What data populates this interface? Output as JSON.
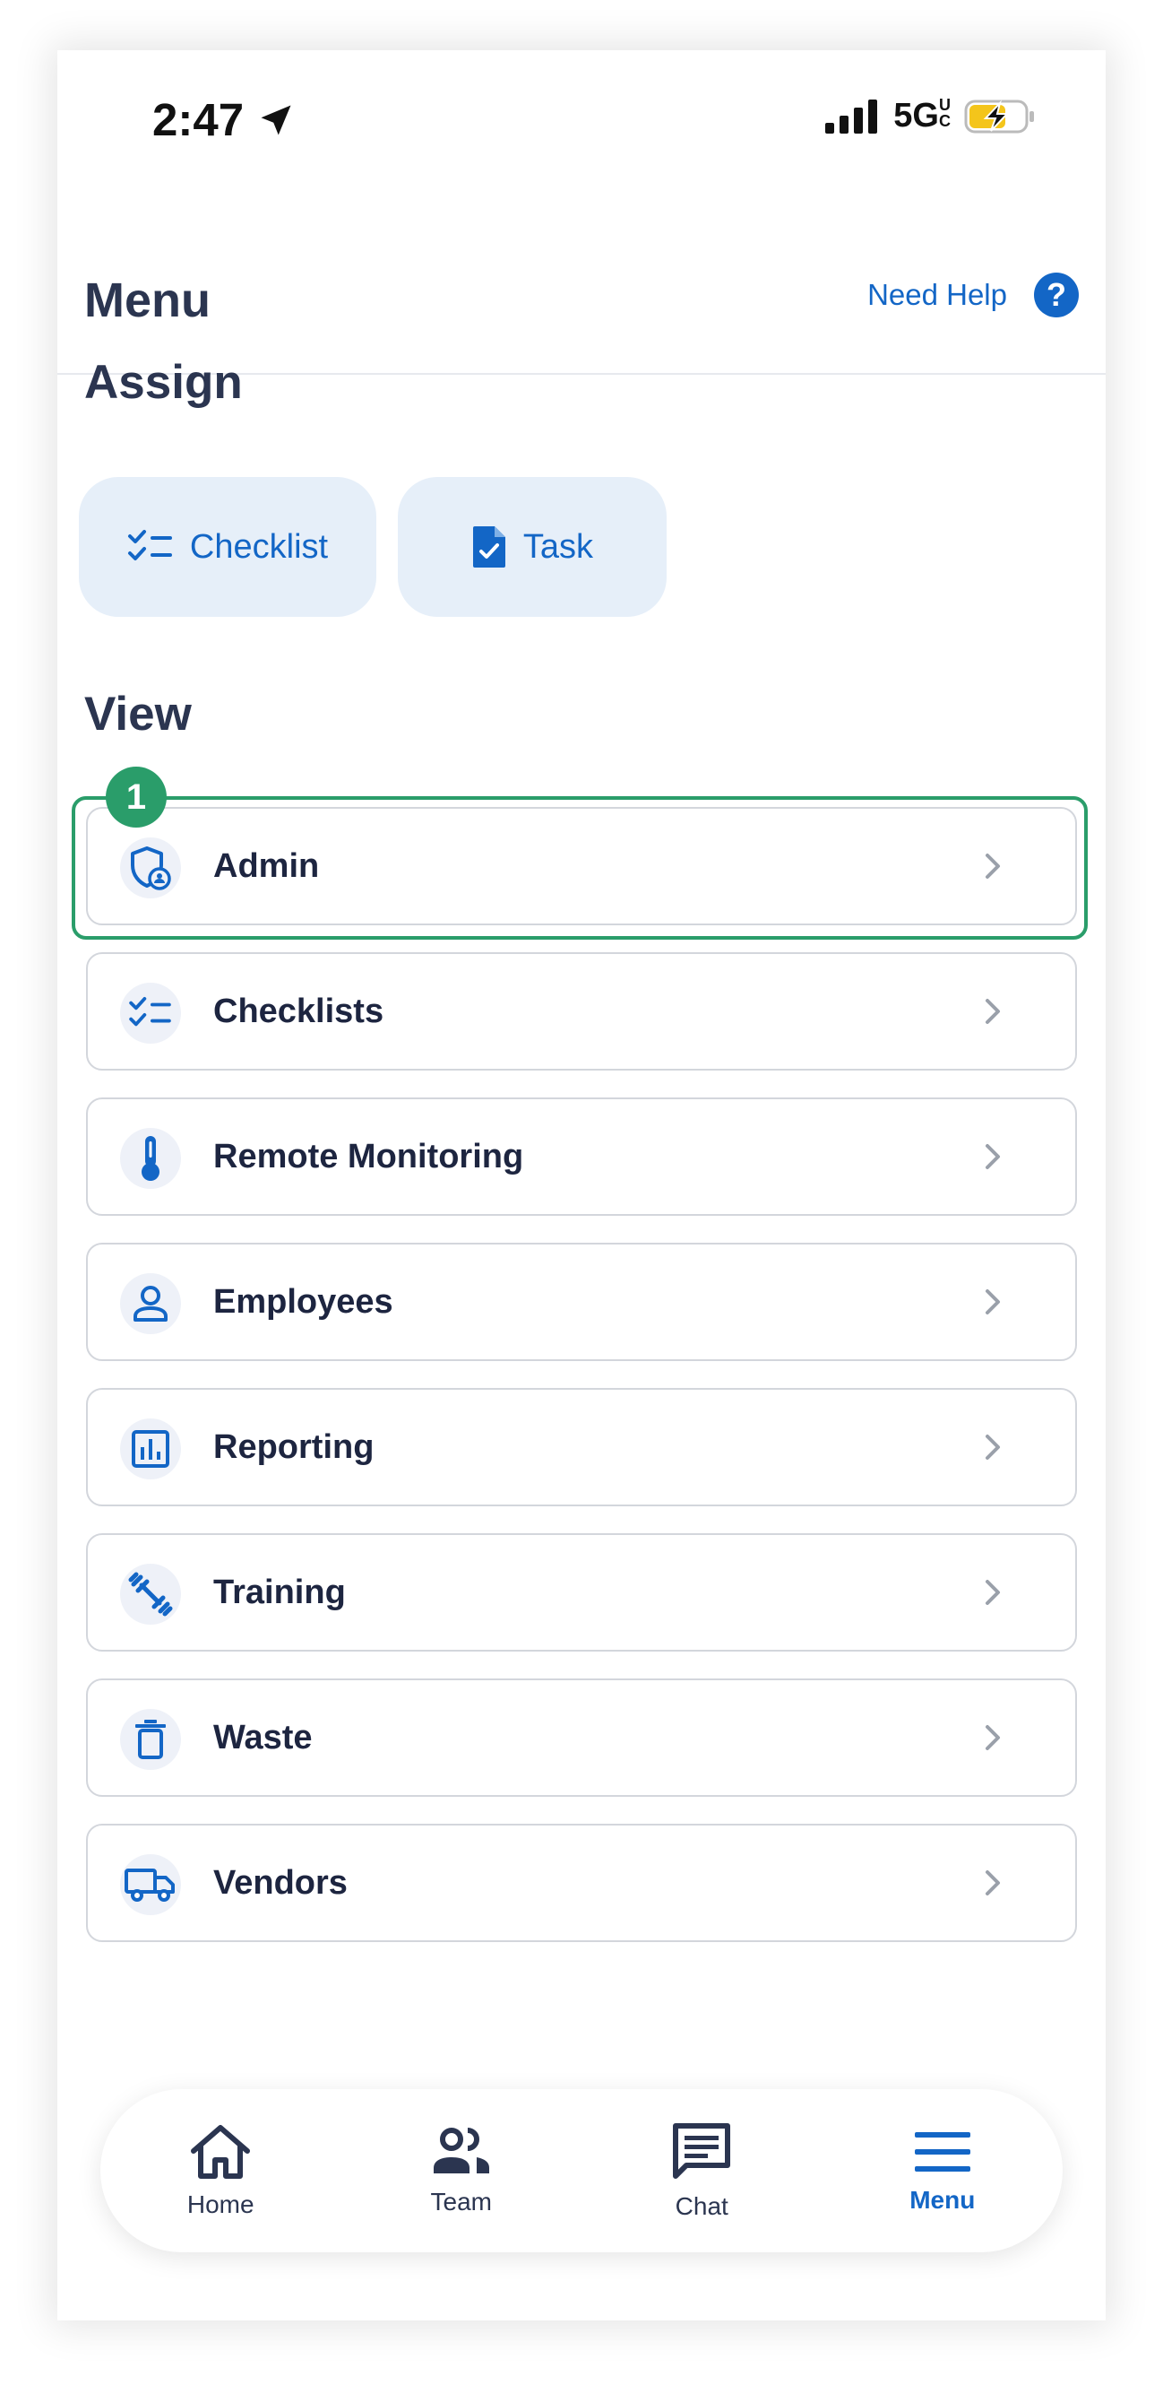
{
  "status": {
    "time": "2:47",
    "network": "5G",
    "network_badge": "UC"
  },
  "header": {
    "title": "Menu",
    "help_label": "Need Help",
    "help_symbol": "?"
  },
  "assign": {
    "title": "Assign",
    "buttons": [
      {
        "label": "Checklist",
        "icon": "checklist-icon"
      },
      {
        "label": "Task",
        "icon": "task-document-icon"
      }
    ]
  },
  "view": {
    "title": "View",
    "highlight_badge": "1",
    "items": [
      {
        "label": "Admin",
        "icon": "shield-user-icon"
      },
      {
        "label": "Checklists",
        "icon": "checklist-icon"
      },
      {
        "label": "Remote Monitoring",
        "icon": "thermometer-icon"
      },
      {
        "label": "Employees",
        "icon": "person-icon"
      },
      {
        "label": "Reporting",
        "icon": "bar-chart-icon"
      },
      {
        "label": "Training",
        "icon": "dumbbell-icon"
      },
      {
        "label": "Waste",
        "icon": "trash-icon"
      },
      {
        "label": "Vendors",
        "icon": "truck-icon"
      }
    ]
  },
  "tabs": [
    {
      "label": "Home",
      "icon": "home-icon"
    },
    {
      "label": "Team",
      "icon": "team-icon"
    },
    {
      "label": "Chat",
      "icon": "chat-icon"
    },
    {
      "label": "Menu",
      "icon": "hamburger-icon",
      "active": true
    }
  ],
  "colors": {
    "accent": "#1366c6",
    "highlight": "#2a9d6a",
    "title": "#2b3550",
    "battery": "#f4c51b"
  }
}
